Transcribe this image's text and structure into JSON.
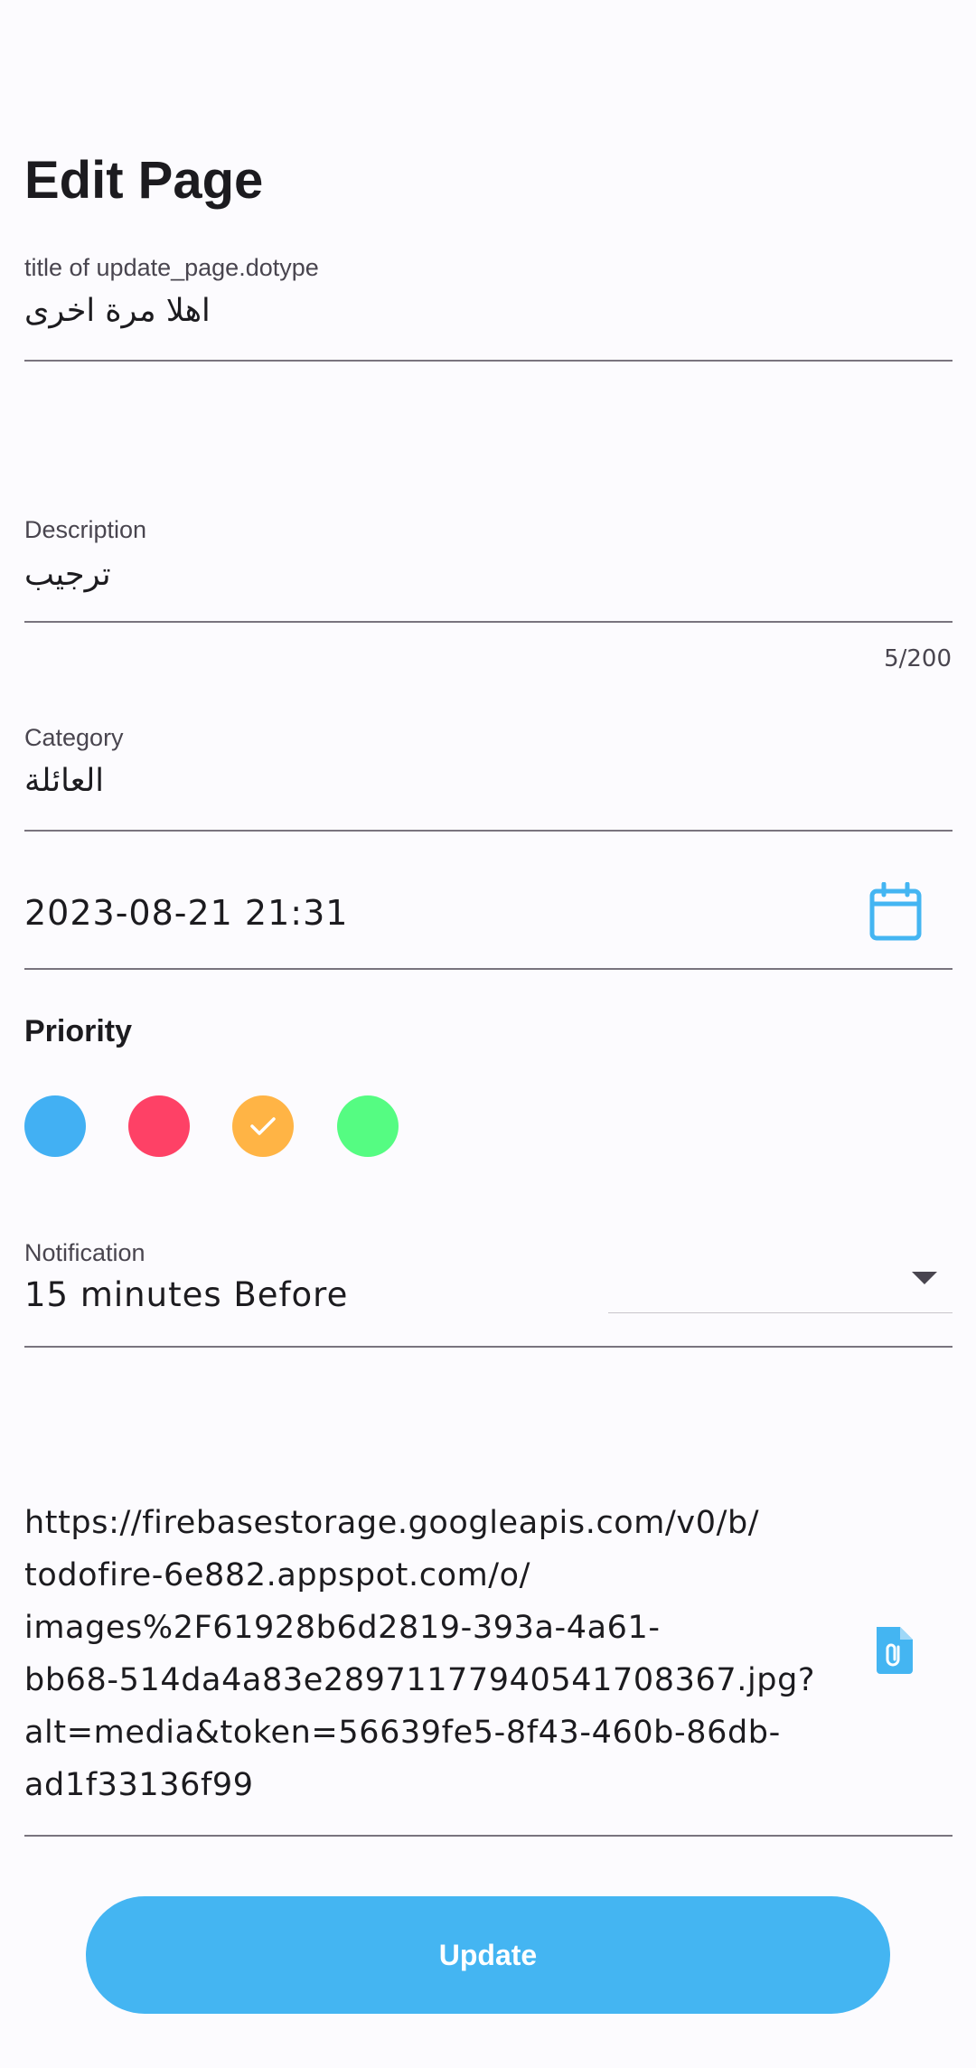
{
  "page": {
    "title": "Edit Page"
  },
  "fields": {
    "title": {
      "label": "title of update_page.dotype",
      "value": "اهلا مرة اخرى"
    },
    "description": {
      "label": "Description",
      "value": "ترجيب",
      "counter": "5/200"
    },
    "category": {
      "label": "Category",
      "value": "العائلة"
    },
    "date": {
      "value": "2023-08-21 21:31",
      "icon": "calendar-icon"
    }
  },
  "priority": {
    "title": "Priority",
    "options": [
      {
        "color": "#42b0f3",
        "selected": false
      },
      {
        "color": "#fe4166",
        "selected": false
      },
      {
        "color": "#ffb445",
        "selected": true
      },
      {
        "color": "#55fc82",
        "selected": false
      }
    ]
  },
  "notification": {
    "label": "Notification",
    "value": "15 minutes Before",
    "icon": "dropdown-arrow-icon"
  },
  "attachment": {
    "url": "https://firebasestorage.googleapis.com/v0/b/todofire-6e882.appspot.com/o/images%2F61928b6d2819-393a-4a61-bb68-514da4a83e2897117794054170836 7.jpg?alt=media&token=56639fe5-8f43-460b-86db-ad1f33136f99",
    "lines": [
      "https://firebasestorage.googleapis.com/v0/b/",
      "todofire-6e882.appspot.com/o/",
      "images%2F61928b6d2819-393a-4a61-",
      "bb68-514da4a83e2897117794054170836​7.jpg?",
      "alt=media&token=56639fe5-8f43-460b-86db-",
      "ad1f33136f99"
    ],
    "icon": "attach-file-icon"
  },
  "actions": {
    "update_label": "Update"
  },
  "colors": {
    "accent": "#44b5f2",
    "background": "#fcfbfe",
    "underline": "#79747e"
  }
}
